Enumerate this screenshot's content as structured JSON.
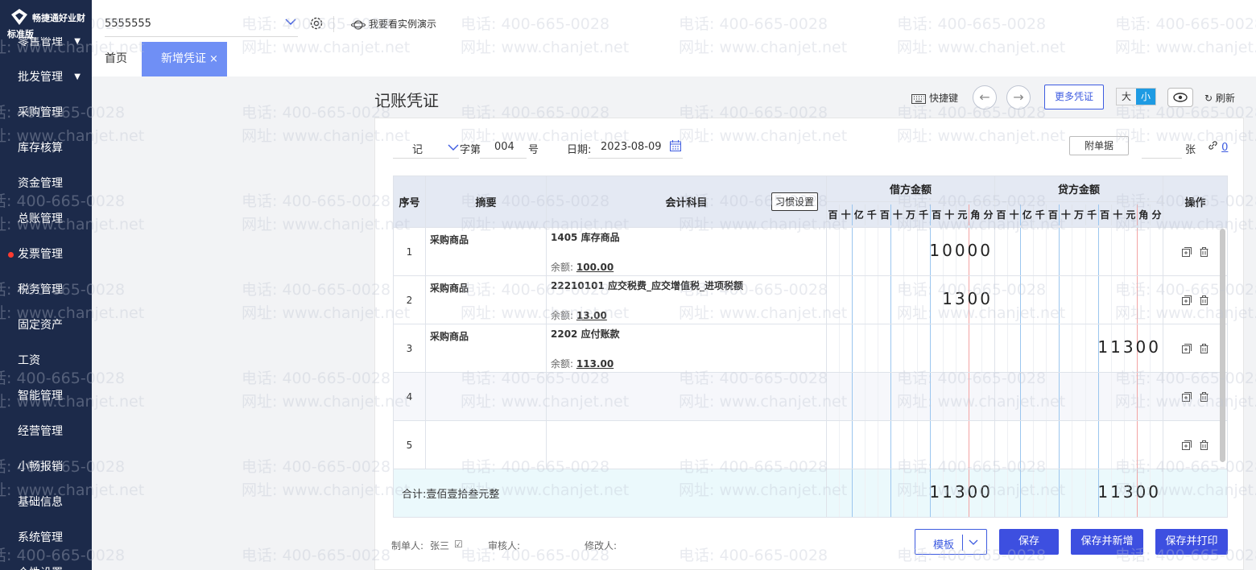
{
  "brand": {
    "name": "畅捷通好业财",
    "edition": "标准版"
  },
  "sidebar": {
    "items": [
      {
        "label": "零售管理",
        "caret": "▼"
      },
      {
        "label": "批发管理",
        "caret": "▼"
      },
      {
        "label": "采购管理"
      },
      {
        "label": "库存核算"
      },
      {
        "label": "资金管理"
      },
      {
        "label": "总账管理"
      },
      {
        "label": "发票管理",
        "dot": true
      },
      {
        "label": "税务管理"
      },
      {
        "label": "固定资产"
      },
      {
        "label": "工资"
      },
      {
        "label": "智能管理"
      },
      {
        "label": "经营管理"
      },
      {
        "label": "小畅报销"
      },
      {
        "label": "基础信息"
      },
      {
        "label": "系统管理"
      },
      {
        "label": "个性设置"
      }
    ]
  },
  "topbar": {
    "company": "5555555",
    "demo_label": "我要看实例演示",
    "tabs": [
      {
        "label": "首页"
      },
      {
        "label": "新增凭证",
        "close": "×"
      }
    ]
  },
  "page": {
    "title": "记账凭证",
    "shortcut_label": "快捷键",
    "prev": "←",
    "next": "→",
    "more_label": "更多凭证",
    "size_large": "大",
    "size_small": "小",
    "refresh_label": "刷新"
  },
  "voucher": {
    "word": "记",
    "word_suffix": "字第",
    "number": "004",
    "number_suffix": "号",
    "date_label": "日期:",
    "date": "2023-08-09",
    "attach_label": "附单据",
    "attach_unit": "张",
    "attach_count": "0"
  },
  "table": {
    "headers": {
      "seq": "序号",
      "summary": "摘要",
      "account": "会计科目",
      "habit_btn": "习惯设置",
      "debit": "借方金额",
      "credit": "贷方金额",
      "ops": "操作"
    },
    "digit_labels": [
      "百",
      "十",
      "亿",
      "千",
      "百",
      "十",
      "万",
      "千",
      "百",
      "十",
      "元",
      "角",
      "分"
    ],
    "rows": [
      {
        "seq": "1",
        "summary": "采购商品",
        "account": "1405 库存商品",
        "balance_label": "余额:",
        "balance": "100.00",
        "debit": "10000",
        "credit": ""
      },
      {
        "seq": "2",
        "summary": "采购商品",
        "account": "22210101 应交税费_应交增值税_进项税额",
        "balance_label": "余额:",
        "balance": "13.00",
        "debit": "1300",
        "credit": ""
      },
      {
        "seq": "3",
        "summary": "采购商品",
        "account": "2202 应付账款",
        "balance_label": "余额:",
        "balance": "113.00",
        "debit": "",
        "credit": "11300"
      },
      {
        "seq": "4",
        "summary": "",
        "account": "",
        "balance_label": "",
        "balance": "",
        "debit": "",
        "credit": ""
      },
      {
        "seq": "5",
        "summary": "",
        "account": "",
        "balance_label": "",
        "balance": "",
        "debit": "",
        "credit": ""
      }
    ],
    "total_label": "合计:壹佰壹拾叁元整",
    "total_debit": "11300",
    "total_credit": "11300"
  },
  "footer": {
    "maker_label": "制单人:",
    "maker": "张三",
    "reviewer_label": "审核人:",
    "modifier_label": "修改人:",
    "template_label": "模板",
    "save_label": "保存",
    "save_new_label": "保存并新增",
    "save_print_label": "保存并打印"
  },
  "watermark": {
    "phone": "电话: 400-665-0028",
    "site": "网址: www.chanjet.net"
  },
  "colors": {
    "sidebar_bg": "#1c2a4a",
    "primary": "#3d4fe0",
    "tab_active": "#6f8ff5",
    "total_bg": "#ebf9fc",
    "header_bg": "#e4e9f3"
  }
}
